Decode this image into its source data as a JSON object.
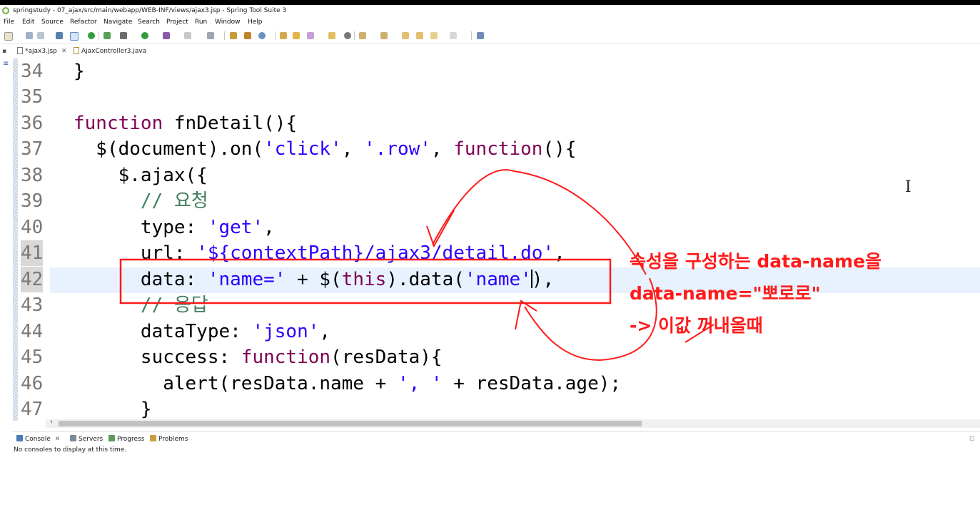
{
  "window": {
    "title": "springstudy - 07_ajax/src/main/webapp/WEB-INF/views/ajax3.jsp - Spring Tool Suite 3"
  },
  "menu": [
    "File",
    "Edit",
    "Source",
    "Refactor",
    "Navigate",
    "Search",
    "Project",
    "Run",
    "Window",
    "Help"
  ],
  "editor_tabs": [
    {
      "label": "*ajax3.jsp",
      "active": true
    },
    {
      "label": "AjaxController3.java",
      "active": false
    }
  ],
  "code_lines": [
    {
      "num": "34",
      "text": "}"
    },
    {
      "num": "35",
      "text": ""
    },
    {
      "num": "36",
      "text": "function fnDetail(){"
    },
    {
      "num": "37",
      "text": "  $(document).on('click', '.row', function(){"
    },
    {
      "num": "38",
      "text": "    $.ajax({"
    },
    {
      "num": "39",
      "text": "      // 요청"
    },
    {
      "num": "40",
      "text": "      type: 'get',"
    },
    {
      "num": "41",
      "text": "      url: '${contextPath}/ajax3/detail.do',"
    },
    {
      "num": "42",
      "text": "      data: 'name=' + $(this).data('name'),"
    },
    {
      "num": "43",
      "text": "      // 응답"
    },
    {
      "num": "44",
      "text": "      dataType: 'json',"
    },
    {
      "num": "45",
      "text": "      success: function(resData){"
    },
    {
      "num": "46",
      "text": "        alert(resData.name + ', ' + resData.age);"
    },
    {
      "num": "47",
      "text": "      }"
    }
  ],
  "annotation": {
    "line1": "속성을 구성하는 data-name을",
    "line2": "data-name=\"뽀로로\"",
    "line3": "-> 이값 꺼내올때",
    "color": "#ff1a1a"
  },
  "bottom_panel": {
    "tabs": [
      "Console",
      "Servers",
      "Progress",
      "Problems"
    ],
    "message": "No consoles to display at this time."
  }
}
